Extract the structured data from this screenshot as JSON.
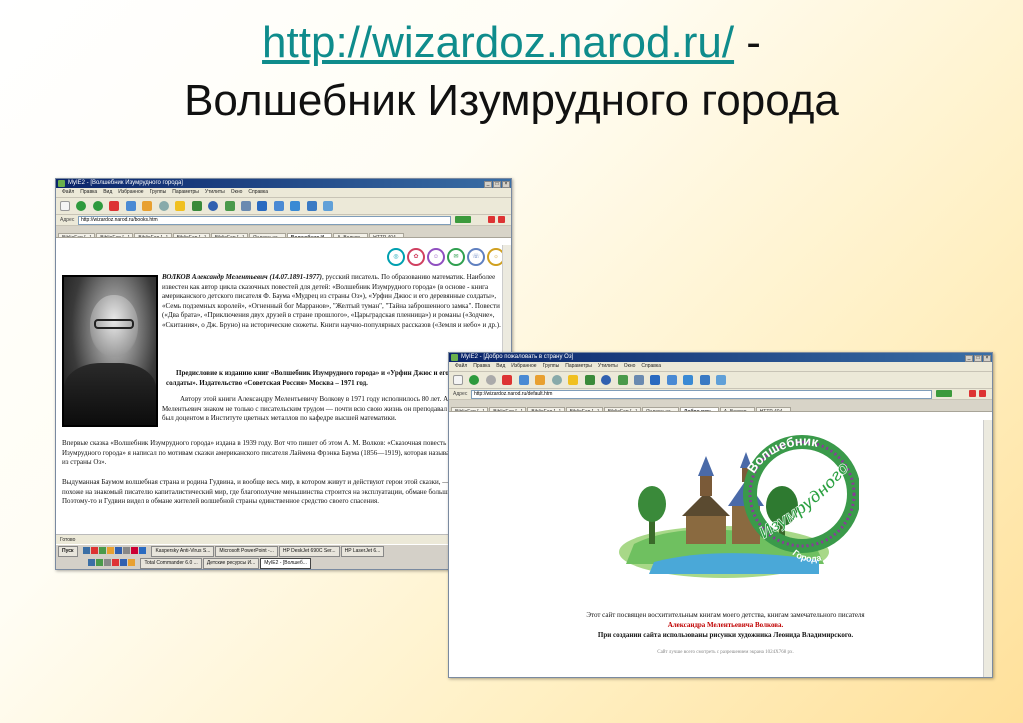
{
  "slide": {
    "title_link": "http://wizardoz.narod.ru/",
    "title_sep": " -",
    "title_line2": "Волшебник Изумрудного города"
  },
  "window1": {
    "title": "MyIE2 - [Волшебник Изумрудного города]",
    "menu": [
      "Файл",
      "Правка",
      "Вид",
      "Избранное",
      "Группы",
      "Параметры",
      "Утилиты",
      "Окно",
      "Справка"
    ],
    "address_label": "Адрес",
    "address": "http://wizardoz.narod.ru/books.htm",
    "tabs": [
      "BiblioFap.[...]",
      "BiblioFap.[...]",
      "BiblioFap.[...]",
      "BiblioFap.[...]",
      "BiblioFap.[...]",
      "Яндекс: ка...",
      "Волшебник И...",
      "А. Волков...",
      "HTTP 404..."
    ],
    "active_tab": 6,
    "bio_name": "ВОЛКОВ Александр Мелентьевич (14.07.1891-1977)",
    "bio_text": ", русский писатель. По образованию математик. Наиболее известен как автор цикла сказочных повестей для детей: «Волшебник Изумрудного города» (в основе - книга американского детского писателя Ф. Баума «Мудрец из страны Оз»), «Урфин Джюс и его деревянные солдаты», «Семь подземных королей», «Огненный бог Марранов», \"Желтый туман\", \"Тайна заброшенного замка\". Повести («Два брата», «Приключения двух друзей в стране прошлого», «Царьградская пленница») и романы («Зодчие», «Скитания», о Дж. Бруно) на исторические сюжеты. Книги научно-популярных рассказов («Земля и небо» и др.).",
    "preface": "Предисловие к изданию книг «Волшебник Изумрудного города» и «Урфин Джюс и его деревянные солдаты». Издательство «Советская Россия» Москва – 1971 год.",
    "para1": "Автору этой книги Александру Мелентьевичу Волкову в 1971 году исполнилось 80 лет. Александр Мелентьевич знаком не только с писательским трудом — почти всю свою жизнь он преподавал математику, был доцентом в Институте цветных металлов по кафедре высшей математики.",
    "para2": "Впервые сказка «Волшебник Изумрудного города» издана в 1939 году. Вот что пишет об этом А. М. Волков: «Сказочная повесть «Волшебник Изумрудного города» я написал по мотивам сказки американского писателя Лаймена Фрэнка Баума (1856—1919), которая называется «Мудрец из страны Оз».",
    "para3": "Выдуманная Баумом волшебная страна и родина Гудвина, и вообще весь мир, в котором живут и действуют герои этой сказки, — все это очень похоже на знакомый писателю капиталистический мир, где благополучие меньшинства строится на эксплуатации, обмане большинства. Поэтому-то и Гудвин видел в обмане жителей волшебной страны единственное средство своего спасения.",
    "status": "Готово",
    "taskbar_row1": [
      "Пуск",
      "Kaspersky Anti-Virus S...",
      "Microsoft PowerPoint -...",
      "HP DeskJet 690C Ser...",
      "HP LaserJet 6..."
    ],
    "taskbar_row2": [
      "Total Commander 6.0 ...",
      "Детские ресурсы И...",
      "MyIE2 - [Волшеб..."
    ]
  },
  "window2": {
    "title": "MyIE2 - [Добро пожаловать в страну Оз]",
    "menu": [
      "Файл",
      "Правка",
      "Вид",
      "Избранное",
      "Группы",
      "Параметры",
      "Утилиты",
      "Окно",
      "Справка"
    ],
    "address_label": "Адрес",
    "address": "http://wizardoz.narod.ru/default.htm",
    "tabs": [
      "BiblioFap.[...]",
      "BiblioFap.[...]",
      "BiblioFap.[...]",
      "BiblioFap.[...]",
      "BiblioFap.[...]",
      "Яндекс: ка...",
      "Добро пож...",
      "А. Волков...",
      "HTTP 404..."
    ],
    "active_tab": 6,
    "logo_text_top": "Волшебник",
    "logo_text_mid": "Изумрудного",
    "logo_text_bot": "Города",
    "caption_line1": "Этот сайт посвящен восхитительным книгам моего детства, книгам замечательного писателя",
    "caption_name": "Александра Мелентьевича Волкова.",
    "caption_line3": "При создании сайта использованы рисунки художника Леонида Владимирского.",
    "counter": "Сайт лучше всего смотреть с разрешением экрана 1024Х768 px."
  },
  "colors": {
    "link": "#0f8c8c",
    "titlebar": "#0a246a",
    "chrome": "#ece9d8",
    "highlight": "#c00000"
  }
}
